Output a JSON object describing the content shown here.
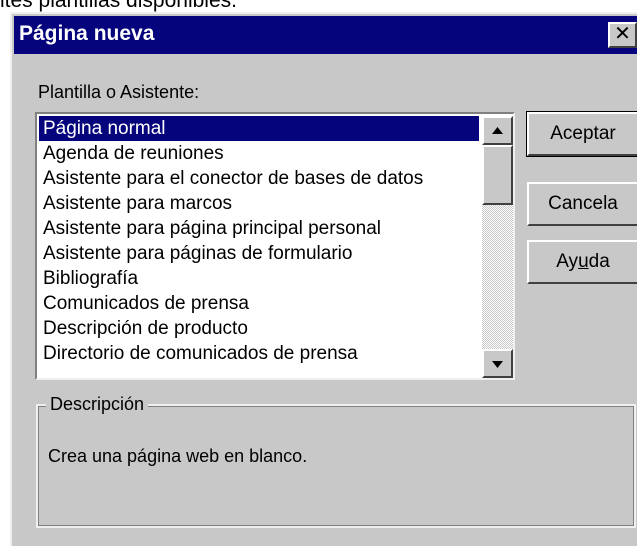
{
  "caption_fragment": "ites plantillas disponibles.",
  "dialog": {
    "title": "Página nueva",
    "close_glyph": "✕"
  },
  "template_label": "Plantilla o Asistente:",
  "templates": [
    "Página normal",
    "Agenda de reuniones",
    "Asistente para el conector de bases de datos",
    "Asistente para marcos",
    "Asistente para página principal personal",
    "Asistente para páginas de formulario",
    "Bibliografía",
    "Comunicados de prensa",
    "Descripción de producto",
    "Directorio de comunicados de prensa"
  ],
  "selected_index": 0,
  "scrollbar": {
    "up_icon": "triangle-up",
    "down_icon": "triangle-down"
  },
  "buttons": {
    "accept": "Aceptar",
    "cancel": "Cancela",
    "help_prefix": "Ay",
    "help_mnemonic": "u",
    "help_suffix": "da"
  },
  "description": {
    "legend": "Descripción",
    "text": "Crea una página web en blanco."
  }
}
